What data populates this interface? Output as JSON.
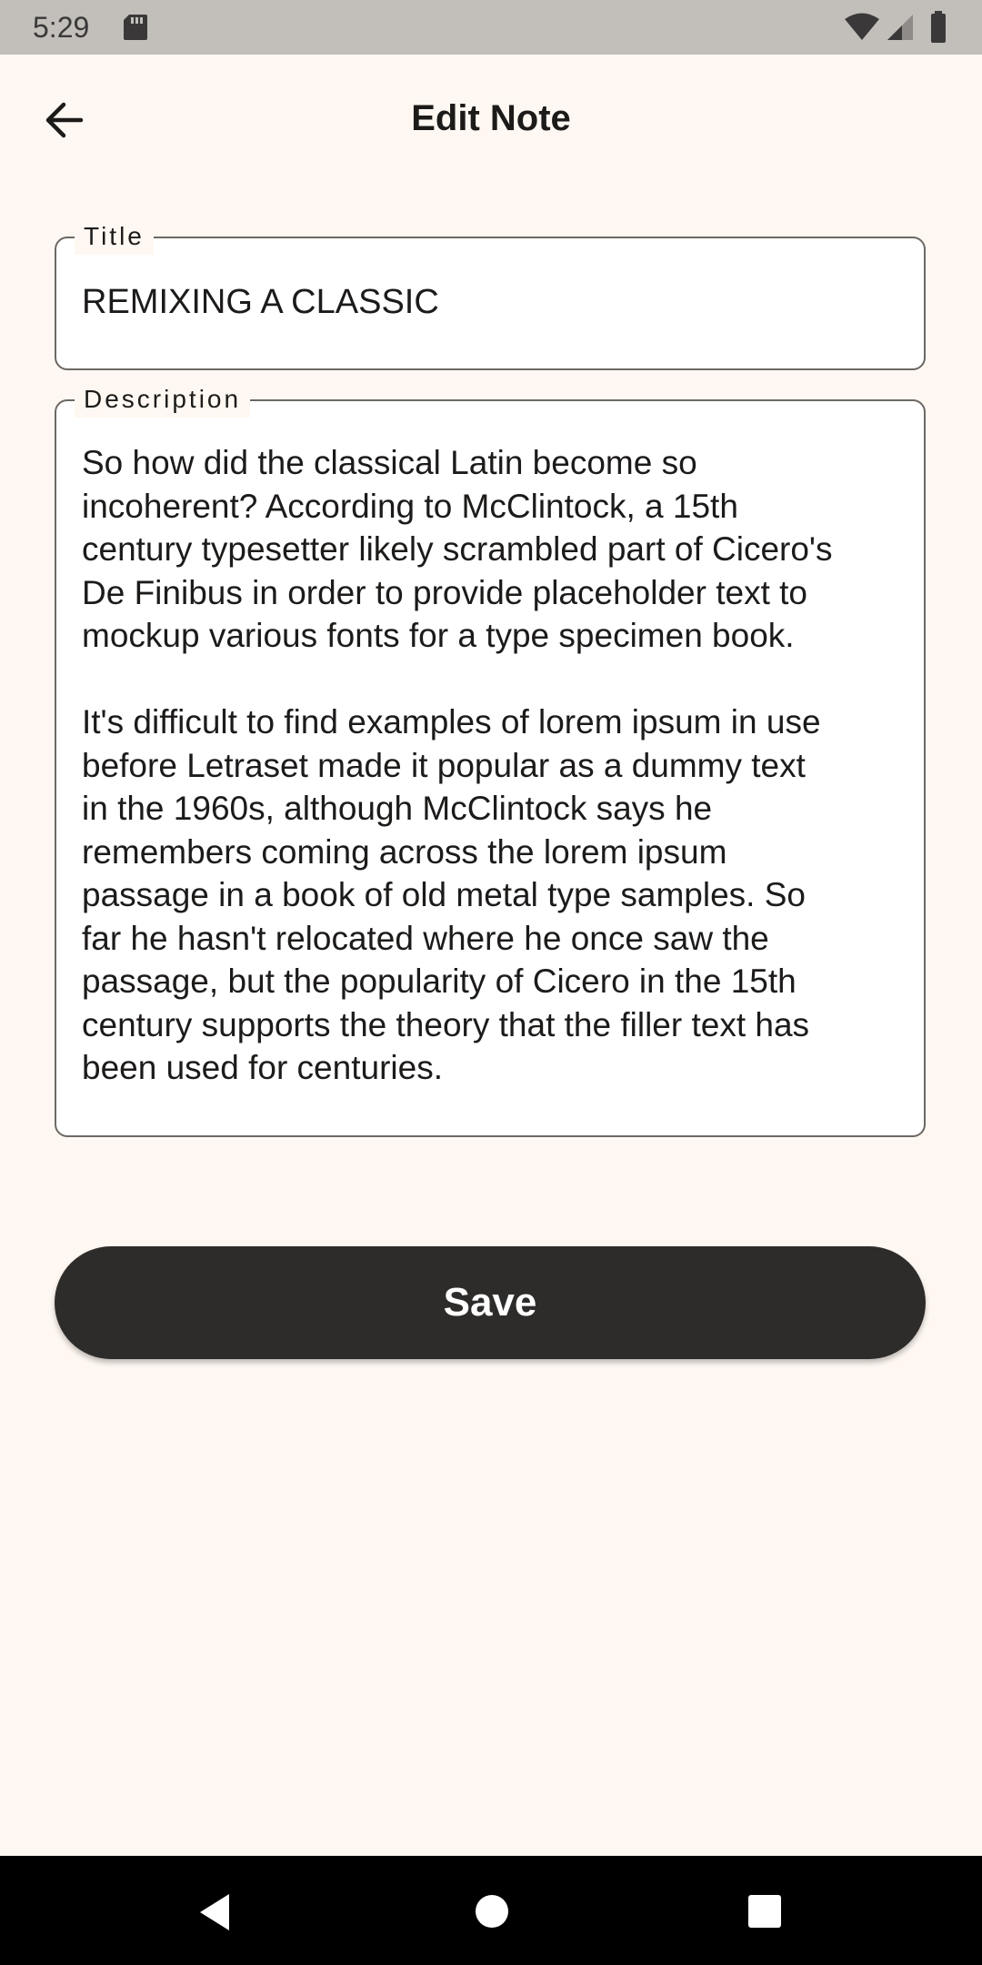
{
  "status_bar": {
    "time": "5:29",
    "icons": [
      "sd-card-icon",
      "wifi-icon",
      "cell-signal-icon",
      "battery-icon"
    ]
  },
  "app_bar": {
    "back_icon": "arrow-back-icon",
    "title": "Edit Note"
  },
  "form": {
    "title_field": {
      "label": "Title",
      "value": "REMIXING A CLASSIC"
    },
    "description_field": {
      "label": "Description",
      "value": "So how did the classical Latin become so\nincoherent? According to McClintock, a 15th\ncentury typesetter likely scrambled part of Cicero's\nDe Finibus in order to provide placeholder text to\nmockup various fonts for a type specimen book.\n\nIt's difficult to find examples of lorem ipsum in use\nbefore Letraset made it popular as a dummy text\nin the 1960s, although McClintock says he\nremembers coming across the lorem ipsum\npassage in a book of old metal type samples. So\nfar he hasn't relocated where he once saw the\npassage, but the popularity of Cicero in the 15th\ncentury supports the theory that the filler text has\nbeen used for centuries."
    },
    "save_label": "Save"
  },
  "nav_bar": {
    "icons": [
      "nav-back-icon",
      "nav-home-icon",
      "nav-recents-icon"
    ]
  },
  "colors": {
    "background": "#fff8f2",
    "status_bar": "#c2bfbb",
    "field_border": "#6d6864",
    "button": "#2e2c2b",
    "button_text": "#ffffff",
    "nav_bar": "#000000"
  }
}
